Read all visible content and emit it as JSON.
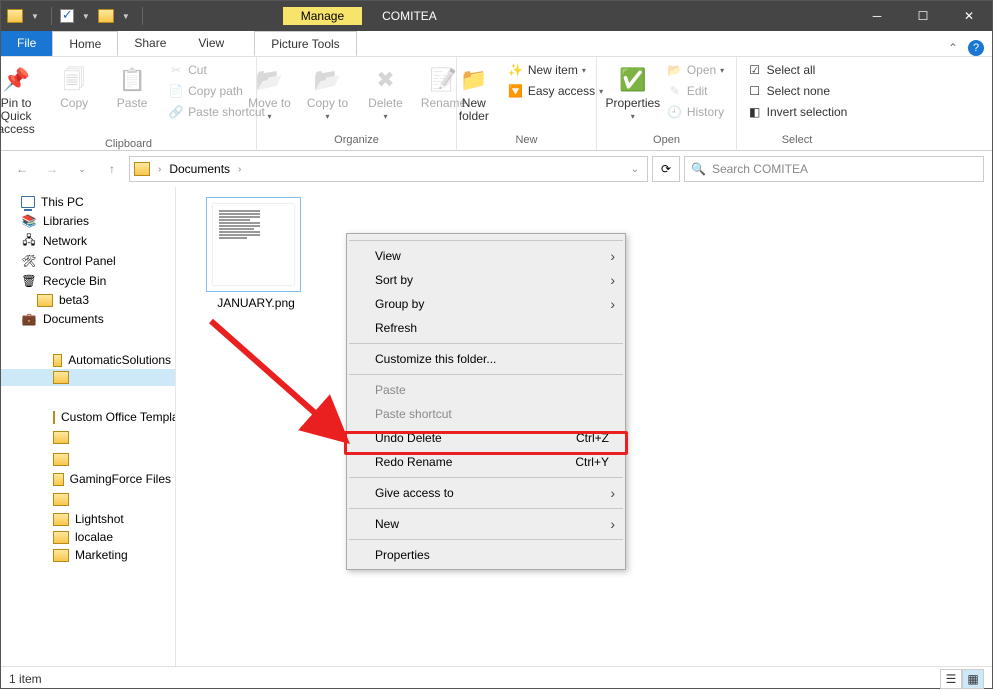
{
  "title": {
    "manage": "Manage",
    "pictools": "Picture Tools",
    "window": "COMITEA"
  },
  "tabs": {
    "file": "File",
    "home": "Home",
    "share": "Share",
    "view": "View"
  },
  "ribbon": {
    "clipboard": {
      "pin": "Pin to Quick access",
      "copy": "Copy",
      "paste": "Paste",
      "cut": "Cut",
      "copypath": "Copy path",
      "pasteshort": "Paste shortcut",
      "label": "Clipboard"
    },
    "organize": {
      "moveto": "Move to",
      "copyto": "Copy to",
      "delete": "Delete",
      "rename": "Rename",
      "label": "Organize"
    },
    "new": {
      "newfolder": "New folder",
      "newitem": "New item",
      "easy": "Easy access",
      "label": "New"
    },
    "open": {
      "properties": "Properties",
      "open": "Open",
      "edit": "Edit",
      "history": "History",
      "label": "Open"
    },
    "select": {
      "all": "Select all",
      "none": "Select none",
      "invert": "Invert selection",
      "label": "Select"
    }
  },
  "addressbar": {
    "crumb1": "Documents",
    "search_placeholder": "Search COMITEA"
  },
  "tree": {
    "thispc": "This PC",
    "libraries": "Libraries",
    "network": "Network",
    "cpanel": "Control Panel",
    "recycle": "Recycle Bin",
    "beta3": "beta3",
    "documents": "Documents",
    "auto": "AutomaticSolutions",
    "custom": "Custom Office Templates",
    "gaming": "GamingForce Files",
    "lightshot": "Lightshot",
    "localae": "localae",
    "marketing": "Marketing"
  },
  "file": {
    "name": "JANUARY.png"
  },
  "menu": {
    "view": "View",
    "sortby": "Sort by",
    "groupby": "Group by",
    "refresh": "Refresh",
    "customize": "Customize this folder...",
    "paste": "Paste",
    "pasteshort": "Paste shortcut",
    "undo": "Undo Delete",
    "undo_key": "Ctrl+Z",
    "redo": "Redo Rename",
    "redo_key": "Ctrl+Y",
    "giveaccess": "Give access to",
    "new": "New",
    "properties": "Properties"
  },
  "status": {
    "items": "1 item"
  }
}
